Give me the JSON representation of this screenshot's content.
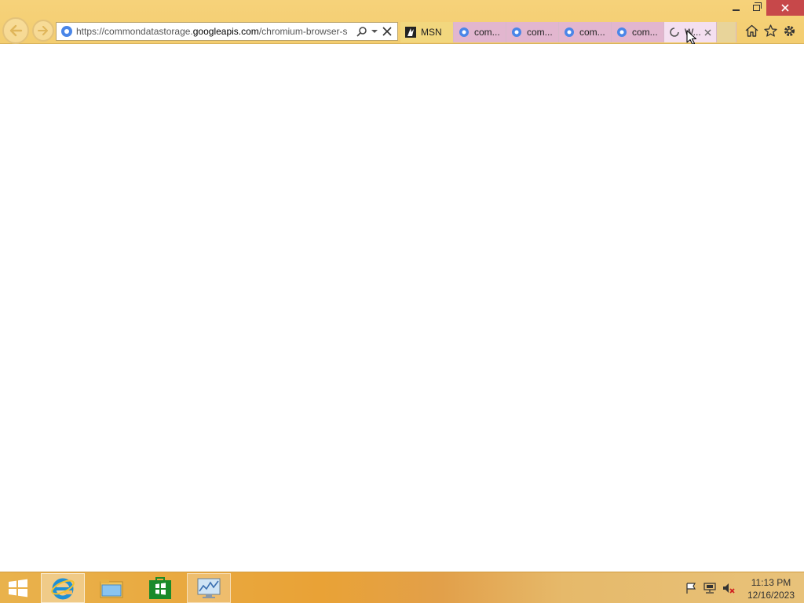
{
  "window": {
    "minimize_icon": "minimize-icon",
    "restore_icon": "restore-icon",
    "close_icon": "close-icon",
    "close_color": "#c7484a"
  },
  "navigation": {
    "back_icon": "back-arrow-icon",
    "forward_icon": "forward-arrow-icon"
  },
  "address_bar": {
    "url_prefix": "https://commondatastorage.",
    "url_domain": "googleapis.com",
    "url_suffix": "/chromium-browser-s",
    "search_icon": "search-icon",
    "dropdown_icon": "dropdown-icon",
    "stop_icon": "stop-icon"
  },
  "tabs": [
    {
      "label": "MSN",
      "icon": "msn-icon"
    },
    {
      "label": "com...",
      "icon": "page-icon"
    },
    {
      "label": "com...",
      "icon": "page-icon"
    },
    {
      "label": "com...",
      "icon": "page-icon"
    },
    {
      "label": "com...",
      "icon": "page-icon"
    },
    {
      "label": "W...",
      "icon": "loading-icon",
      "active": true
    }
  ],
  "toolbar": {
    "home_icon": "home-icon",
    "favorites_icon": "star-icon",
    "tools_icon": "gear-icon"
  },
  "taskbar": {
    "apps": [
      "internet-explorer",
      "file-explorer",
      "store",
      "resource-monitor"
    ],
    "clock_time": "11:13 PM",
    "clock_date": "12/16/2023"
  },
  "colors": {
    "chrome": "#f3cd70",
    "tab_pink": "#e2b6cf",
    "tab_active": "#f4dff0",
    "taskbar": "#e9a236"
  }
}
